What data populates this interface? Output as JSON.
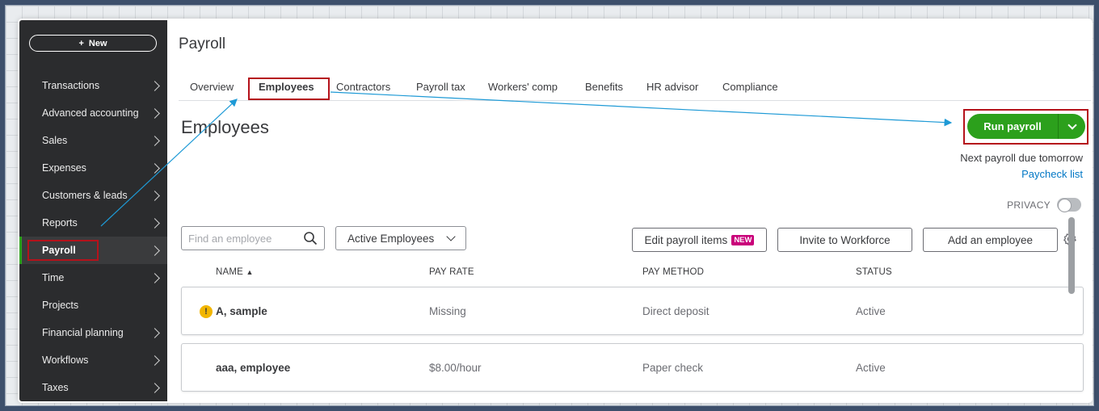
{
  "sidebar": {
    "new_button": "New",
    "new_icon": "plus-icon",
    "items": [
      {
        "label": "Transactions"
      },
      {
        "label": "Advanced accounting"
      },
      {
        "label": "Sales"
      },
      {
        "label": "Expenses"
      },
      {
        "label": "Customers & leads"
      },
      {
        "label": "Reports"
      },
      {
        "label": "Payroll"
      },
      {
        "label": "Time"
      },
      {
        "label": "Projects"
      },
      {
        "label": "Financial planning"
      },
      {
        "label": "Workflows"
      },
      {
        "label": "Taxes"
      }
    ]
  },
  "header": {
    "title": "Payroll",
    "tabs": [
      "Overview",
      "Employees",
      "Contractors",
      "Payroll tax",
      "Workers' comp",
      "Benefits",
      "HR advisor",
      "Compliance"
    ]
  },
  "employees": {
    "title": "Employees",
    "run_payroll": "Run payroll",
    "next_payroll": "Next payroll due tomorrow",
    "paycheck_list": "Paycheck list",
    "privacy": "PRIVACY",
    "search_placeholder": "Find an employee",
    "filter": "Active Employees",
    "edit_payroll_items": "Edit payroll items",
    "new_badge": "NEW",
    "invite": "Invite to Workforce",
    "add_employee": "Add an employee",
    "columns": {
      "name": "NAME",
      "name_sort": "▲",
      "pay_rate": "PAY RATE",
      "pay_method": "PAY METHOD",
      "status": "STATUS"
    },
    "rows": [
      {
        "name": "A, sample",
        "pay_rate": "Missing",
        "pay_method": "Direct deposit",
        "status": "Active",
        "warning": "!"
      },
      {
        "name": "aaa, employee",
        "pay_rate": "$8.00/hour",
        "pay_method": "Paper check",
        "status": "Active"
      }
    ]
  },
  "colors": {
    "accent_green": "#2ca01c",
    "highlight_red": "#b5121b",
    "annotation_arrow": "#1e9ad6",
    "link_blue": "#0077c5",
    "sidebar_bg": "#2b2c2e"
  }
}
